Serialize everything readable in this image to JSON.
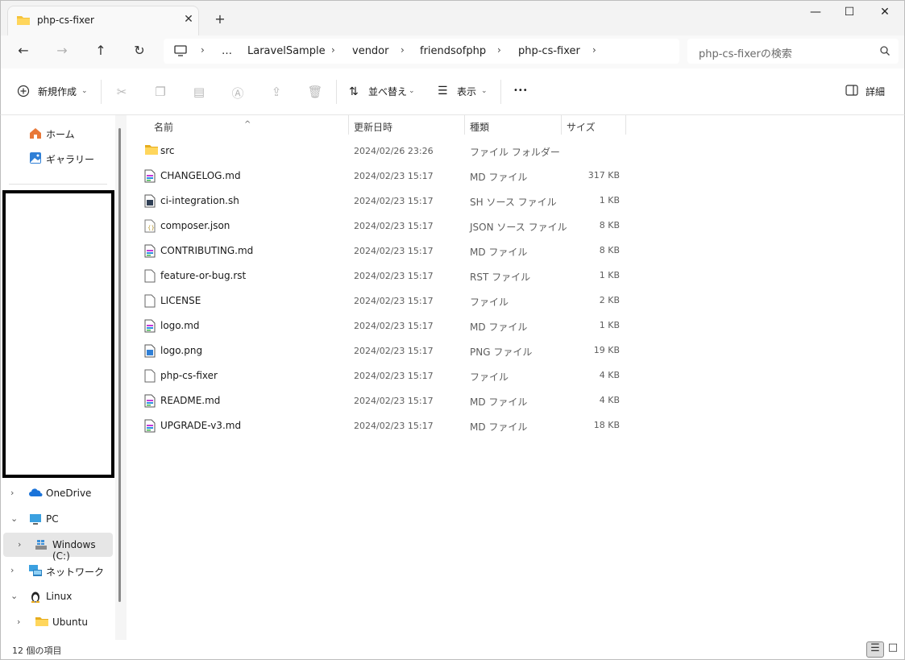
{
  "window": {
    "tab_title": "php-cs-fixer",
    "tab_close": "✕",
    "new_tab": "+",
    "minimize": "—",
    "maximize": "☐",
    "close": "✕"
  },
  "nav": {
    "back": "←",
    "forward": "→",
    "up": "↑",
    "refresh": "↻",
    "breadcrumb": [
      "…",
      "LaravelSample",
      "vendor",
      "friendsofphp",
      "php-cs-fixer"
    ],
    "search_placeholder": "php-cs-fixerの検索"
  },
  "commands": {
    "new": "新規作成",
    "sort": "並べ替え",
    "view": "表示",
    "more": "•••",
    "details": "詳細"
  },
  "sidebar": {
    "items": [
      {
        "label": "ホーム",
        "icon": "home-icon"
      },
      {
        "label": "ギャラリー",
        "icon": "gallery-icon"
      },
      {
        "label": "OneDrive",
        "icon": "onedrive-icon"
      },
      {
        "label": "PC",
        "icon": "pc-icon"
      },
      {
        "label": "Windows (C:)",
        "icon": "drive-icon"
      },
      {
        "label": "ネットワーク",
        "icon": "network-icon"
      },
      {
        "label": "Linux",
        "icon": "linux-icon"
      },
      {
        "label": "Ubuntu",
        "icon": "folder-icon"
      }
    ]
  },
  "columns": {
    "name": "名前",
    "date": "更新日時",
    "type": "種類",
    "size": "サイズ"
  },
  "files": [
    {
      "name": "src",
      "date": "2024/02/26 23:26",
      "type": "ファイル フォルダー",
      "size": "",
      "icon": "folder-icon"
    },
    {
      "name": "CHANGELOG.md",
      "date": "2024/02/23 15:17",
      "type": "MD ファイル",
      "size": "317 KB",
      "icon": "md-file-icon"
    },
    {
      "name": "ci-integration.sh",
      "date": "2024/02/23 15:17",
      "type": "SH ソース ファイル",
      "size": "1 KB",
      "icon": "sh-file-icon"
    },
    {
      "name": "composer.json",
      "date": "2024/02/23 15:17",
      "type": "JSON ソース ファイル",
      "size": "8 KB",
      "icon": "json-file-icon"
    },
    {
      "name": "CONTRIBUTING.md",
      "date": "2024/02/23 15:17",
      "type": "MD ファイル",
      "size": "8 KB",
      "icon": "md-file-icon"
    },
    {
      "name": "feature-or-bug.rst",
      "date": "2024/02/23 15:17",
      "type": "RST ファイル",
      "size": "1 KB",
      "icon": "file-icon"
    },
    {
      "name": "LICENSE",
      "date": "2024/02/23 15:17",
      "type": "ファイル",
      "size": "2 KB",
      "icon": "file-icon"
    },
    {
      "name": "logo.md",
      "date": "2024/02/23 15:17",
      "type": "MD ファイル",
      "size": "1 KB",
      "icon": "md-file-icon"
    },
    {
      "name": "logo.png",
      "date": "2024/02/23 15:17",
      "type": "PNG ファイル",
      "size": "19 KB",
      "icon": "png-file-icon"
    },
    {
      "name": "php-cs-fixer",
      "date": "2024/02/23 15:17",
      "type": "ファイル",
      "size": "4 KB",
      "icon": "file-icon"
    },
    {
      "name": "README.md",
      "date": "2024/02/23 15:17",
      "type": "MD ファイル",
      "size": "4 KB",
      "icon": "md-file-icon"
    },
    {
      "name": "UPGRADE-v3.md",
      "date": "2024/02/23 15:17",
      "type": "MD ファイル",
      "size": "18 KB",
      "icon": "md-file-icon"
    }
  ],
  "status": {
    "item_count": "12 個の項目"
  }
}
